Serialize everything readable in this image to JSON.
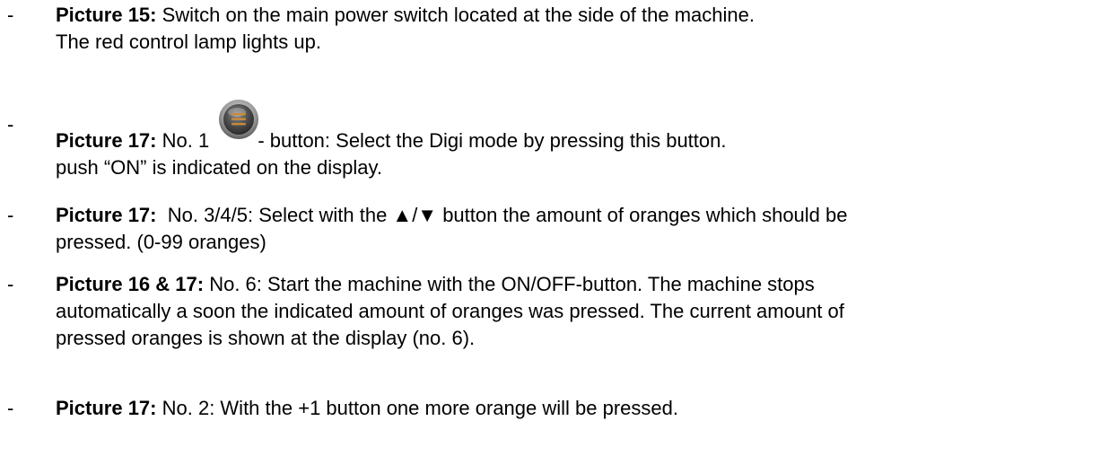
{
  "bullet_marker": "-",
  "items": [
    {
      "lead": "Picture 15:",
      "lines": [
        " Switch on the main power switch located at the side of the machine.",
        "The red control lamp lights up."
      ]
    },
    {
      "lead": "Picture 17:",
      "before_icon": " No. 1 ",
      "icon": "menu-button-icon",
      "after_icon": "- button: Select the Digi mode by pressing this button.",
      "lines": [
        "push “ON” is indicated on the display."
      ]
    },
    {
      "lead": "Picture 17:",
      "lines": [
        "  No. 3/4/5: Select with the ▲/▼ button the amount of oranges which should be",
        "pressed. (0-99 oranges)"
      ]
    },
    {
      "lead": "Picture 16 & 17:",
      "lines": [
        " No. 6: Start the machine with the ON/OFF-button. The machine stops",
        "automatically a soon the indicated amount of oranges was pressed. The current amount of",
        "pressed oranges is shown at the display (no. 6)."
      ]
    },
    {
      "lead": "Picture 17:",
      "lines": [
        " No. 2: With the +1 button one more orange will be pressed."
      ]
    }
  ]
}
